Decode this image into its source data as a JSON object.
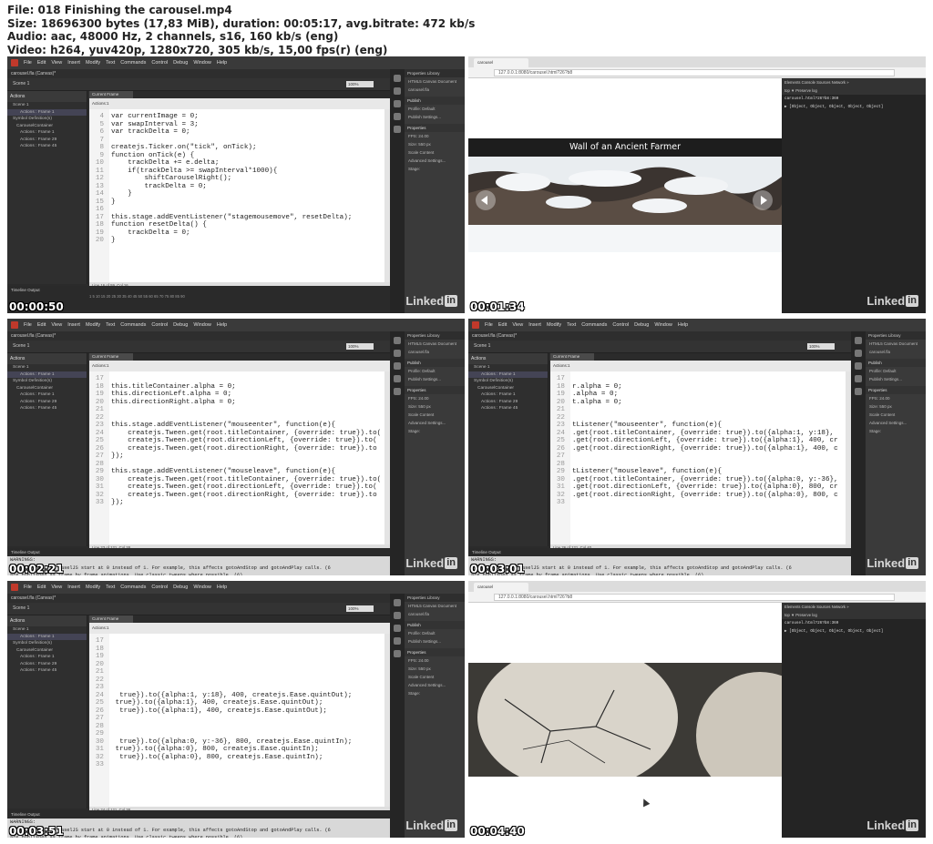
{
  "header": {
    "file": "File: 018 Finishing the carousel.mp4",
    "size": "Size: 18696300 bytes (17,83 MiB), duration: 00:05:17, avg.bitrate: 472 kb/s",
    "audio": "Audio: aac, 48000 Hz, 2 channels, s16, 160 kb/s (eng)",
    "video": "Video: h264, yuv420p, 1280x720, 305 kb/s, 15,00 fps(r) (eng)"
  },
  "brand": {
    "linked": "Linked",
    "in": "in"
  },
  "ide": {
    "menu": [
      "File",
      "Edit",
      "View",
      "Insert",
      "Modify",
      "Text",
      "Commands",
      "Control",
      "Debug",
      "Window",
      "Help"
    ],
    "doc_tab": "carousel.fla (Canvas)*",
    "scene": "Scene 1",
    "zoom": "100%",
    "actions_title": "Actions",
    "tree": [
      "Scene 1",
      "Actions : Frame 1",
      "Symbol Definition(s)",
      "CarouselContainer",
      "Actions : Frame 1",
      "Actions : Frame 29",
      "Actions : Frame 45"
    ],
    "current_frame": "Current Frame",
    "actions_sub": "Actions:1",
    "timeline_tabs": "Timeline   Output",
    "frame_numbers": "1   5   10   15   20   25   30   35   40   45   50   55   60   65   70   75   80   85   90",
    "warning": "WARNINGS:",
    "output_line1": "Frame numbers in EaselJS start at 0 instead of 1. For example, this affects gotoAndStop and gotoAndPlay calls. (6",
    "output_line2": "are published as frame by frame animations. Use classic tweens where possible. (6)",
    "props_tabs": "Properties   Library",
    "props_doc": "HTML5 Canvas Document",
    "props_file": "carousel.fla",
    "props_publish": "Publish",
    "props_profile": "Profile: Default",
    "props_settings": "Publish Settings...",
    "props_section": "Properties",
    "props_fps": "FPS: 24.00",
    "props_size": "Size: 550 px",
    "props_scale": "Scale Content",
    "props_advanced": "Advanced Settings...",
    "props_stage": "Stage:"
  },
  "browser": {
    "tab": "carousel",
    "url": "127.0.0.1:8080/carousel.html?26?b8",
    "devtools_tabs": "Elements   Console   Sources   Network   »",
    "devtools_filter": "top   ▼   Preserve log",
    "devtools_link": "carousel.html?26?b8:360",
    "console_output": "▶ [Object, Object, Object, Object, Object]",
    "carousel_caption": "Wall of an Ancient Farmer"
  },
  "thumbnails": [
    {
      "timestamp": "00:00:50",
      "status": "Line 16 of 59, Col 16",
      "code": [
        [
          "4",
          "var currentImage = 0;"
        ],
        [
          "5",
          "var swapInterval = 3;"
        ],
        [
          "6",
          "var trackDelta = 0;"
        ],
        [
          "7",
          ""
        ],
        [
          "8",
          "createjs.Ticker.on(\"tick\", onTick);"
        ],
        [
          "9",
          "function onTick(e) {"
        ],
        [
          "10",
          "    trackDelta += e.delta;"
        ],
        [
          "11",
          "    if(trackDelta >= swapInterval*1000){"
        ],
        [
          "12",
          "        shiftCarouselRight();"
        ],
        [
          "13",
          "        trackDelta = 0;"
        ],
        [
          "14",
          "    }"
        ],
        [
          "15",
          "}"
        ],
        [
          "16",
          ""
        ],
        [
          "17",
          "this.stage.addEventListener(\"stagemousemove\", resetDelta);"
        ],
        [
          "18",
          "function resetDelta() {"
        ],
        [
          "19",
          "    trackDelta = 0;"
        ],
        [
          "20",
          "}"
        ]
      ]
    },
    {
      "timestamp": "00:01:34"
    },
    {
      "timestamp": "00:02:21",
      "status": "Line 23 of 121, Col 28",
      "code": [
        [
          "17",
          ""
        ],
        [
          "18",
          "this.titleContainer.alpha = 0;"
        ],
        [
          "19",
          "this.directionLeft.alpha = 0;"
        ],
        [
          "20",
          "this.directionRight.alpha = 0;"
        ],
        [
          "21",
          ""
        ],
        [
          "22",
          ""
        ],
        [
          "23",
          "this.stage.addEventListener(\"mouseenter\", function(e){"
        ],
        [
          "24",
          "    createjs.Tween.get(root.titleContainer, {override: true}).to("
        ],
        [
          "25",
          "    createjs.Tween.get(root.directionLeft, {override: true}).to("
        ],
        [
          "26",
          "    createjs.Tween.get(root.directionRight, {override: true}).to"
        ],
        [
          "27",
          "});"
        ],
        [
          "28",
          ""
        ],
        [
          "29",
          "this.stage.addEventListener(\"mouseleave\", function(e){"
        ],
        [
          "30",
          "    createjs.Tween.get(root.titleContainer, {override: true}).to("
        ],
        [
          "31",
          "    createjs.Tween.get(root.directionLeft, {override: true}).to("
        ],
        [
          "32",
          "    createjs.Tween.get(root.directionRight, {override: true}).to"
        ],
        [
          "33",
          "});"
        ]
      ]
    },
    {
      "timestamp": "00:03:01",
      "status": "Line 26 of 121, Col 40",
      "code": [
        [
          "17",
          ""
        ],
        [
          "18",
          "r.alpha = 0;"
        ],
        [
          "19",
          ".alpha = 0;"
        ],
        [
          "20",
          "t.alpha = 0;"
        ],
        [
          "21",
          ""
        ],
        [
          "22",
          ""
        ],
        [
          "23",
          "tListener(\"mouseenter\", function(e){"
        ],
        [
          "24",
          ".get(root.titleContainer, {override: true}).to({alpha:1, y:18},"
        ],
        [
          "25",
          ".get(root.directionLeft, {override: true}).to({alpha:1}, 400, cr"
        ],
        [
          "26",
          ".get(root.directionRight, {override: true}).to({alpha:1}, 400, c"
        ],
        [
          "27",
          ""
        ],
        [
          "28",
          ""
        ],
        [
          "29",
          "tListener(\"mouseleave\", function(e){"
        ],
        [
          "30",
          ".get(root.titleContainer, {override: true}).to({alpha:0, y:-36},"
        ],
        [
          "31",
          ".get(root.directionLeft, {override: true}).to({alpha:0}, 800, cr"
        ],
        [
          "32",
          ".get(root.directionRight, {override: true}).to({alpha:0}, 800, c"
        ],
        [
          "33",
          ""
        ]
      ]
    },
    {
      "timestamp": "00:03:51",
      "status": "Line 24 of 121, Col 38",
      "code": [
        [
          "17",
          ""
        ],
        [
          "18",
          ""
        ],
        [
          "19",
          ""
        ],
        [
          "20",
          ""
        ],
        [
          "21",
          ""
        ],
        [
          "22",
          ""
        ],
        [
          "23",
          ""
        ],
        [
          "24",
          "  true}).to({alpha:1, y:18}, 400, createjs.Ease.quintOut);"
        ],
        [
          "25",
          " true}).to({alpha:1}, 400, createjs.Ease.quintOut);"
        ],
        [
          "26",
          "  true}).to({alpha:1}, 400, createjs.Ease.quintOut);"
        ],
        [
          "27",
          ""
        ],
        [
          "28",
          ""
        ],
        [
          "29",
          ""
        ],
        [
          "30",
          "  true}).to({alpha:0, y:-36}, 800, createjs.Ease.quintIn);"
        ],
        [
          "31",
          " true}).to({alpha:0}, 800, createjs.Ease.quintIn);"
        ],
        [
          "32",
          "  true}).to({alpha:0}, 800, createjs.Ease.quintIn);"
        ],
        [
          "33",
          ""
        ]
      ]
    },
    {
      "timestamp": "00:04:40"
    }
  ]
}
